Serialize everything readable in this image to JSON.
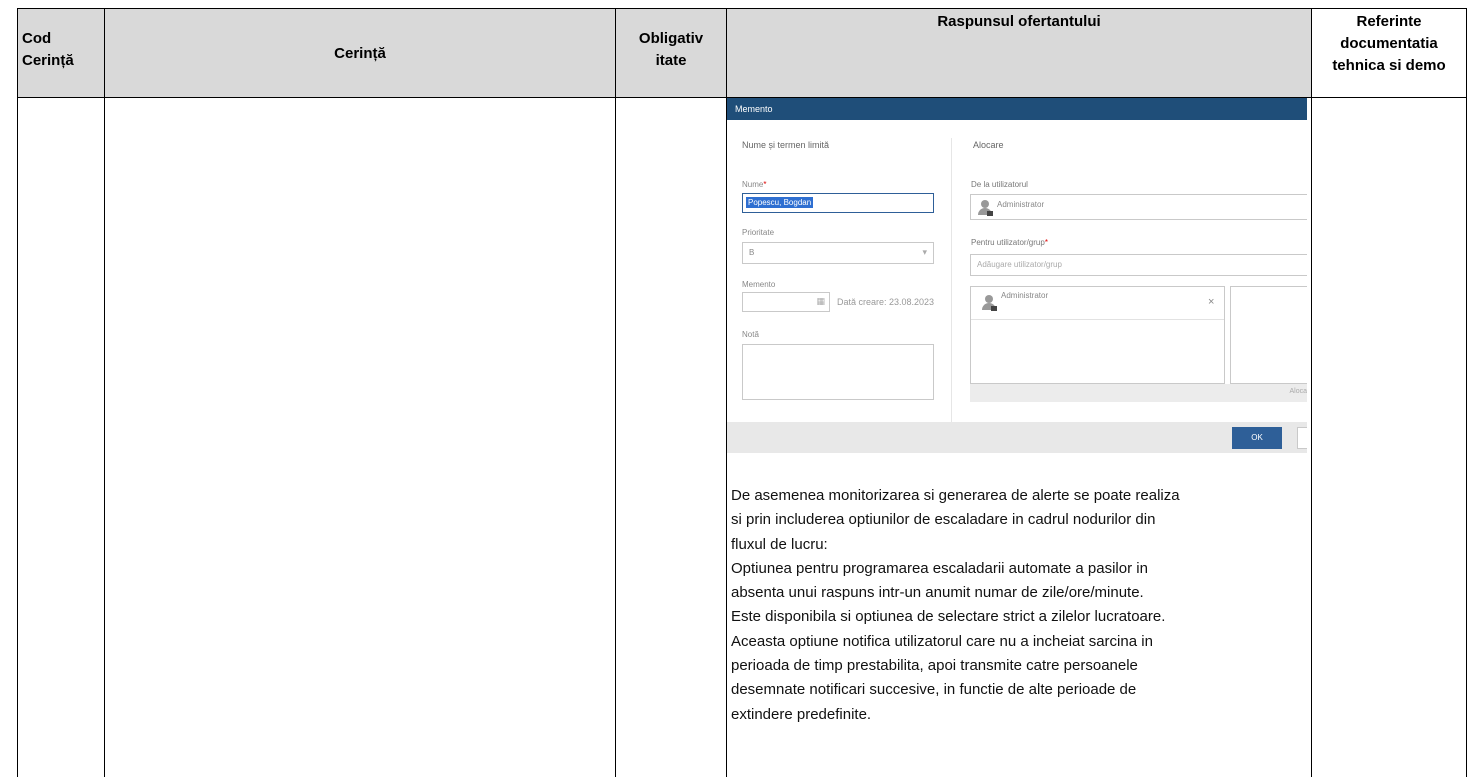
{
  "table": {
    "headers": {
      "cod_line1": "Cod",
      "cod_line2": "Cerință",
      "cerinta": "Cerință",
      "obligativ_line1": "Obligativ",
      "obligativ_line2": "itate",
      "raspuns": "Raspunsul ofertantului",
      "ref_line1": "Referinte",
      "ref_line2": "documentatia",
      "ref_line3": "tehnica si demo"
    }
  },
  "dialog": {
    "title": "Memento",
    "section_left": "Nume și termen limită",
    "section_right": "Alocare",
    "nume_label": "Nume",
    "nume_value": "Popescu, Bogdan",
    "prioritate_label": "Prioritate",
    "prioritate_value": "B",
    "memento_label": "Memento",
    "data_creare": "Dată creare: 23.08.2023",
    "nota_label": "Notă",
    "de_la_label": "De la utilizatorul",
    "de_la_value": "Administrator",
    "pentru_label": "Pentru utilizator/grup",
    "add_placeholder": "Adăugare utilizator/grup",
    "assigned_user": "Administrator",
    "remove_glyph": "×",
    "alocare_link": "Aloca",
    "ok_label": "OK",
    "required_mark": "*",
    "calendar_glyph": "▦",
    "dropdown_glyph": "▾"
  },
  "response_text": [
    "De asemenea monitorizarea si generarea de alerte se poate realiza",
    "si prin includerea optiunilor de escaladare in cadrul nodurilor din",
    "fluxul de lucru:",
    "Optiunea pentru programarea escaladarii automate a pasilor in",
    "absenta unui raspuns intr-un anumit numar de zile/ore/minute.",
    "Este disponibila si optiunea de selectare strict a zilelor lucratoare.",
    "Aceasta optiune notifica utilizatorul care nu a incheiat sarcina in",
    "perioada de timp prestabilita, apoi transmite catre persoanele",
    "desemnate notificari succesive, in functie de alte perioade de",
    "extindere predefinite."
  ]
}
